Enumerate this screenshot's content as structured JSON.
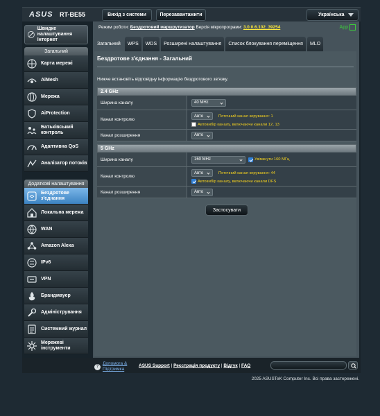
{
  "header": {
    "brand": "ASUS",
    "model": "RT-BE55",
    "logout_label": "Вихід з системи",
    "reboot_label": "Перезавантажити",
    "language": "Українська"
  },
  "sidebar": {
    "qis_label": "Швидке налаштування Інтернет",
    "general_header": "Загальний",
    "general_items": [
      {
        "label": "Карта мережі",
        "icon": "network-map-icon"
      },
      {
        "label": "AiMesh",
        "icon": "aimesh-icon"
      },
      {
        "label": "Мережа",
        "icon": "globe-network-icon"
      },
      {
        "label": "AiProtection",
        "icon": "shield-icon"
      },
      {
        "label": "Батьківський контроль",
        "icon": "parental-control-icon"
      },
      {
        "label": "Адаптивна QoS",
        "icon": "qos-gauge-icon"
      },
      {
        "label": "Аналізатор потоків",
        "icon": "traffic-analyzer-icon"
      }
    ],
    "advanced_header": "Додаткові налаштування",
    "advanced_items": [
      {
        "label": "Бездротове з'єднання",
        "icon": "wireless-icon",
        "active": true
      },
      {
        "label": "Локальна мережа",
        "icon": "home-lan-icon"
      },
      {
        "label": "WAN",
        "icon": "wan-globe-icon"
      },
      {
        "label": "Amazon Alexa",
        "icon": "alexa-icon"
      },
      {
        "label": "IPv6",
        "icon": "ipv6-icon"
      },
      {
        "label": "VPN",
        "icon": "vpn-icon"
      },
      {
        "label": "Брандмауер",
        "icon": "firewall-icon"
      },
      {
        "label": "Адміністрування",
        "icon": "administration-icon"
      },
      {
        "label": "Системний журнал",
        "icon": "system-log-icon"
      },
      {
        "label": "Мережеві інструменти",
        "icon": "network-tools-icon"
      }
    ]
  },
  "status": {
    "mode_label": "Режим роботи:",
    "mode_value": "Бездротовий маршрутизатор",
    "fw_label": "Версія мікропрограми:",
    "fw_value": "3.0.0.6.102_39254",
    "app_label": "App"
  },
  "tabs": [
    {
      "label": "Загальний",
      "active": true
    },
    {
      "label": "WPS"
    },
    {
      "label": "WDS"
    },
    {
      "label": "Розширені налаштування"
    },
    {
      "label": "Список блокування переміщення"
    },
    {
      "label": "MLO"
    }
  ],
  "panel": {
    "title": "Бездротове з'єднання - Загальний",
    "description": "Нижче встановіть відповідну інформацію бездротового зв'язку.",
    "apply_label": "Застосувати"
  },
  "band24": {
    "header": "2.4 GHz",
    "bandwidth_label": "Ширина каналу",
    "bandwidth_value": "40 MHz",
    "control_label": "Канал контролю",
    "control_value": "Авто",
    "control_current": "Поточний канал керування: 1",
    "auto_channel_label": "Автовибір каналу, включаючи канали 12, 13",
    "auto_channel_checked": false,
    "extension_label": "Канал розширення",
    "extension_value": "Авто"
  },
  "band5": {
    "header": "5 GHz",
    "bandwidth_label": "Ширина каналу",
    "bandwidth_value": "160 MHz",
    "enable160_label": "Увімкнути 160 МГц",
    "enable160_checked": true,
    "control_label": "Канал контролю",
    "control_value": "Авто",
    "control_current": "Поточний канал керування: 44",
    "auto_channel_label": "Автовибір каналу, включаючи канали DFS",
    "auto_channel_checked": true,
    "extension_label": "Канал розширення",
    "extension_value": "Авто"
  },
  "footer": {
    "help_label": "Допомога & Підтримка",
    "support": "ASUS Support",
    "register": "Реєстрація продукту",
    "feedback": "Відгук",
    "faq": "FAQ",
    "sep": "|",
    "copyright": "2025 ASUSTeK Computer Inc. Всі права застережені."
  },
  "colors": {
    "accent": "#3c83c2",
    "warning_text": "#f6d21e",
    "app_green": "#3ccc3c"
  }
}
